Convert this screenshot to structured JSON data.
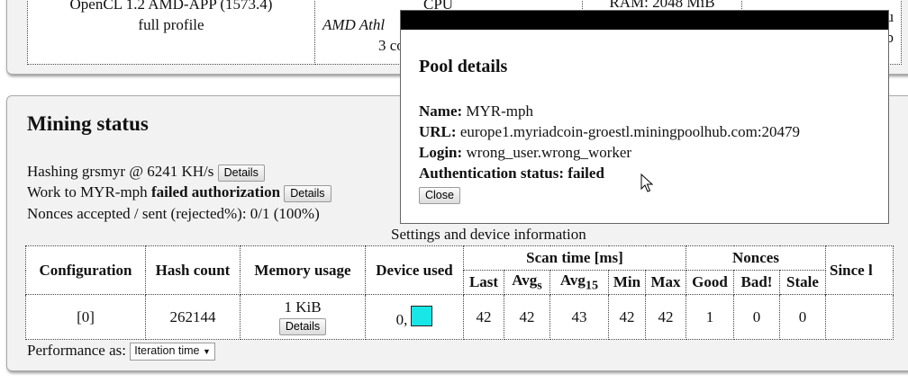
{
  "top_table": {
    "opencl_line1": "OpenCL 1.2 AMD-APP (1573.4)",
    "opencl_line2": "full profile",
    "cpu_header": "CPU",
    "cpu_model": "AMD Athl",
    "cpu_cores": "3 co",
    "ram_header": "RAM: 2048 MiB",
    "extra_line1": "mu",
    "extra_line2": "t b"
  },
  "mining": {
    "title": "Mining status",
    "hashing_text": "Hashing grsmyr @ 6241 KH/s",
    "hashing_details": "Details",
    "work_prefix": "Work to MYR-mph",
    "work_status": "failed authorization",
    "work_details": "Details",
    "nonces_text": "Nonces accepted / sent (rejected%): 0/1 (100%)",
    "settings_caption": "Settings and device information",
    "headers": {
      "configuration": "Configuration",
      "hash_count": "Hash count",
      "memory_usage": "Memory usage",
      "device_used": "Device used",
      "scan_time": "Scan time [ms]",
      "nonces": "Nonces",
      "since": "Since l",
      "last": "Last",
      "avg": "Avg",
      "avg_s_sub": "s",
      "avg_15_sub": "15",
      "min": "Min",
      "max": "Max",
      "good": "Good",
      "bad": "Bad!",
      "stale": "Stale"
    },
    "row": {
      "config": "[0]",
      "hash_count": "262144",
      "memory": "1 KiB",
      "memory_details": "Details",
      "device": "0,",
      "last": "42",
      "avg_s": "42",
      "avg_15": "43",
      "min": "42",
      "max": "42",
      "good": "1",
      "bad": "0",
      "stale": "0",
      "since": ""
    },
    "device_color": "#19e6e6",
    "performance_label": "Performance as:",
    "performance_value": "Iteration time"
  },
  "modal": {
    "title": "Pool details",
    "name_label": "Name:",
    "name_value": "MYR-mph",
    "url_label": "URL:",
    "url_value": "europe1.myriadcoin-groestl.miningpoolhub.com:20479",
    "login_label": "Login:",
    "login_value": "wrong_user.wrong_worker",
    "auth_label": "Authentication status:",
    "auth_value": "failed",
    "close_label": "Close"
  }
}
